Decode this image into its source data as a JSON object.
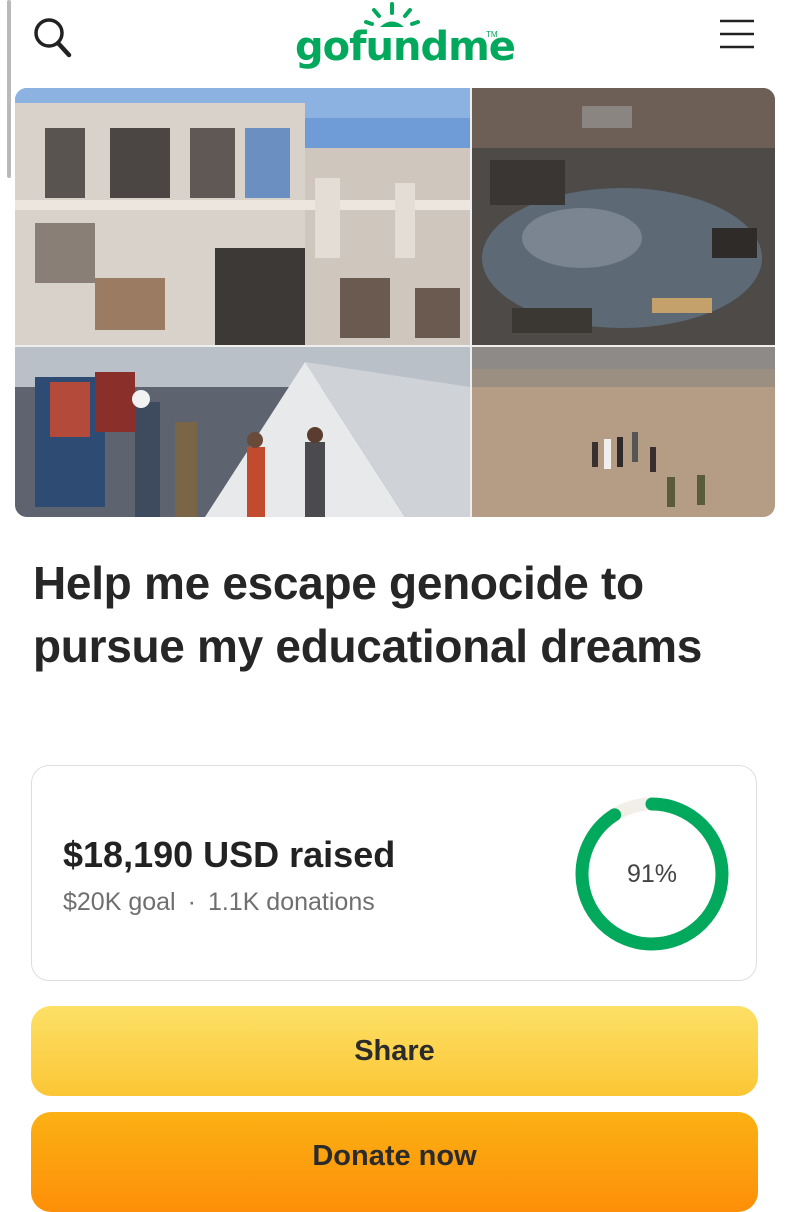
{
  "header": {
    "logo_text": "gofundme",
    "logo_tm": "TM",
    "search_icon": "search-icon",
    "menu_icon": "hamburger-menu-icon"
  },
  "campaign": {
    "title": "Help me escape genocide to pursue my educational dreams",
    "raised_text": "$18,190 USD raised",
    "goal_text": "$20K goal",
    "separator": "·",
    "donations_text": "1.1K donations",
    "progress_label": "91%",
    "progress_fraction": 0.91
  },
  "actions": {
    "share_label": "Share",
    "donate_label": "Donate now"
  },
  "colors": {
    "brand_green": "#02a95c",
    "share_yellow": "#fcd34d",
    "donate_orange": "#fda30e",
    "ring_track": "#f2efe9"
  }
}
